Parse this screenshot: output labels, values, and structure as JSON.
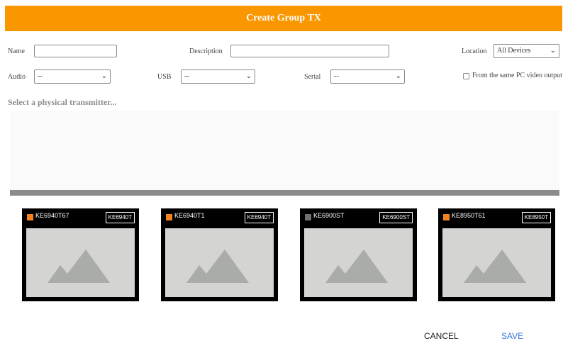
{
  "dialog": {
    "title": "Create Group TX"
  },
  "form": {
    "name_label": "Name",
    "description_label": "Description",
    "location_label": "Location",
    "location_value": "All Devices",
    "audio_label": "Audio",
    "audio_value": "--",
    "usb_label": "USB",
    "usb_value": "--",
    "serial_label": "Serial",
    "serial_value": "--",
    "same_pc_label": "From the same PC video output"
  },
  "hint": "Select a physical transmitter...",
  "devices": [
    {
      "name": "KE6940T67",
      "model": "KE6940T",
      "status_color": "#f58220"
    },
    {
      "name": "KE6940T1",
      "model": "KE6940T",
      "status_color": "#f58220"
    },
    {
      "name": "KE6900ST",
      "model": "KE6900ST",
      "status_color": "#707070"
    },
    {
      "name": "KE8950T61",
      "model": "KE8950T",
      "status_color": "#f58220"
    }
  ],
  "actions": {
    "cancel": "CANCEL",
    "save": "SAVE"
  },
  "colors": {
    "accent": "#fa9600",
    "link": "#3a78d8"
  }
}
